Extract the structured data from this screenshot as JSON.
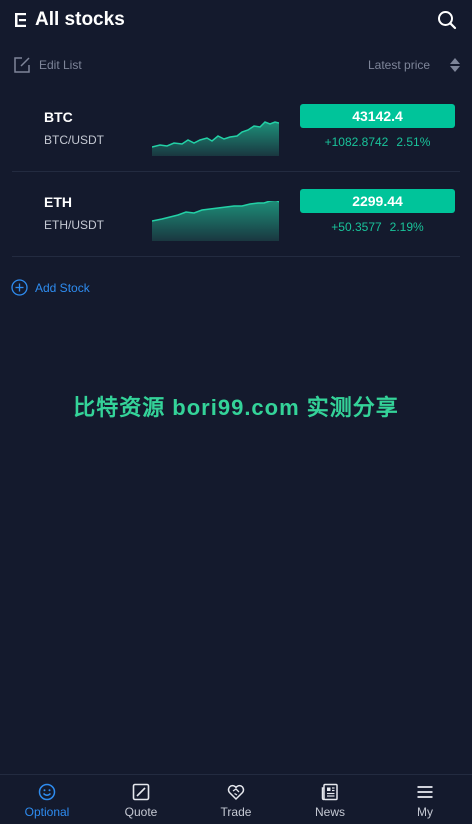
{
  "header": {
    "title": "All stocks",
    "menu_icon": "menu-icon",
    "search_icon": "search-icon"
  },
  "list_header": {
    "edit_label": "Edit List",
    "price_label": "Latest price"
  },
  "stocks": [
    {
      "symbol": "BTC",
      "pair": "BTC/USDT",
      "price": "43142.4",
      "change": "+1082.8742",
      "change_pct": "2.51%"
    },
    {
      "symbol": "ETH",
      "pair": "ETH/USDT",
      "price": "2299.44",
      "change": "+50.3577",
      "change_pct": "2.19%"
    }
  ],
  "add_stock_label": "Add Stock",
  "watermark": "比特资源 bori99.com 实测分享",
  "tabs": [
    {
      "label": "Optional",
      "icon": "smile-icon",
      "active": true
    },
    {
      "label": "Quote",
      "icon": "chart-icon",
      "active": false
    },
    {
      "label": "Trade",
      "icon": "handshake-icon",
      "active": false
    },
    {
      "label": "News",
      "icon": "news-icon",
      "active": false
    },
    {
      "label": "My",
      "icon": "menu-lines-icon",
      "active": false
    }
  ],
  "colors": {
    "background": "#141a2d",
    "accent": "#00c49a",
    "up": "#19c39a",
    "link": "#2e8cf0"
  }
}
